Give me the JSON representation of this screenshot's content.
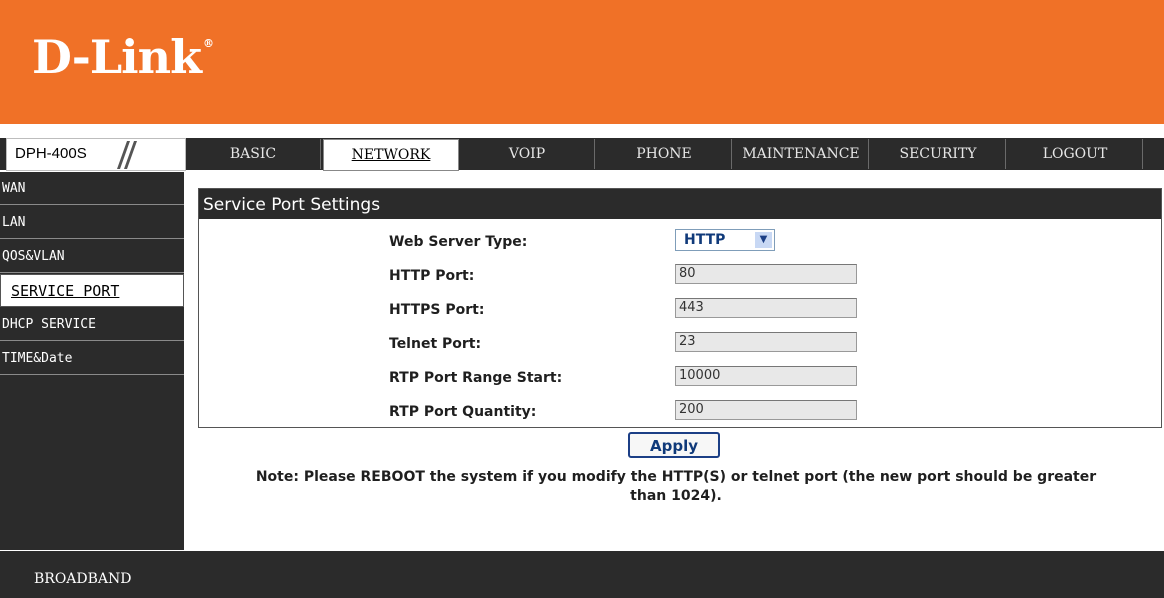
{
  "brand": {
    "name": "D-Link",
    "reg_mark": "®"
  },
  "model": "DPH-400S",
  "nav": {
    "tabs": [
      "BASIC",
      "NETWORK",
      "VOIP",
      "PHONE",
      "MAINTENANCE",
      "SECURITY",
      "LOGOUT"
    ],
    "active": "NETWORK"
  },
  "sidebar": {
    "items": [
      "WAN",
      "LAN",
      "QOS&VLAN",
      "SERVICE PORT",
      "DHCP SERVICE",
      "TIME&Date"
    ],
    "active": "SERVICE PORT"
  },
  "panel": {
    "title": "Service Port Settings",
    "fields": [
      {
        "label": "Web Server Type:",
        "type": "select",
        "value": "HTTP"
      },
      {
        "label": "HTTP Port:",
        "type": "input",
        "value": "80"
      },
      {
        "label": "HTTPS Port:",
        "type": "input",
        "value": "443"
      },
      {
        "label": "Telnet Port:",
        "type": "input",
        "value": "23"
      },
      {
        "label": "RTP Port Range Start:",
        "type": "input",
        "value": "10000"
      },
      {
        "label": "RTP Port Quantity:",
        "type": "input",
        "value": "200"
      }
    ]
  },
  "apply_label": "Apply",
  "note": {
    "line1": "Note: Please REBOOT the system if you modify the HTTP(S) or telnet port (the new port should be greater",
    "line2": "than 1024)."
  },
  "footer": "BROADBAND",
  "colors": {
    "header": "#f07127",
    "dark": "#2b2b2b",
    "select_text": "#103a7a"
  }
}
